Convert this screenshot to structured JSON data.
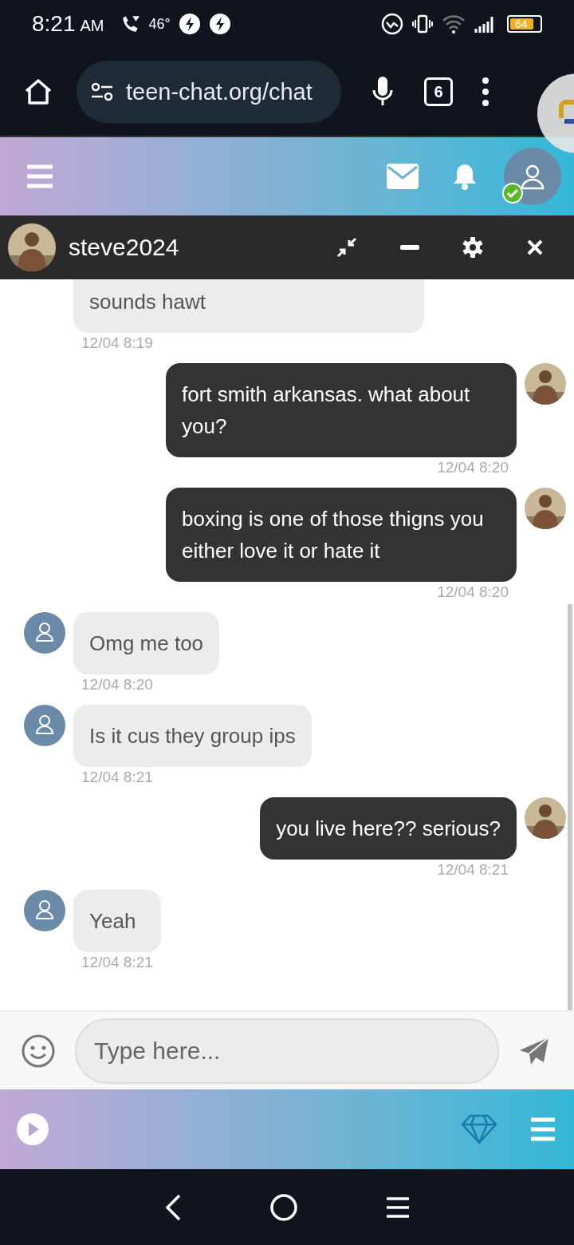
{
  "status_bar": {
    "time": "8:21",
    "ampm": "AM",
    "temperature": "46°",
    "battery": "64"
  },
  "browser": {
    "url": "teen-chat.org/chat",
    "tab_count": "6"
  },
  "chat_header": {
    "username": "steve2024"
  },
  "messages": [
    {
      "kind": "in",
      "text": "sounds hawt",
      "time": "12/04 8:19",
      "cut": true
    },
    {
      "kind": "out",
      "text": "fort smith arkansas. what about you?",
      "time": "12/04 8:20"
    },
    {
      "kind": "out",
      "text": "boxing is one of those thigns you either love it or hate it",
      "time": "12/04 8:20"
    },
    {
      "kind": "in",
      "text": "Omg me too",
      "time": "12/04 8:20"
    },
    {
      "kind": "in",
      "text": "Is it cus they group ips",
      "time": "12/04 8:21"
    },
    {
      "kind": "out",
      "text": "you live here?? serious?",
      "time": "12/04 8:21"
    },
    {
      "kind": "in",
      "text": "Yeah",
      "time": "12/04 8:21"
    }
  ],
  "composer": {
    "placeholder": "Type here..."
  }
}
